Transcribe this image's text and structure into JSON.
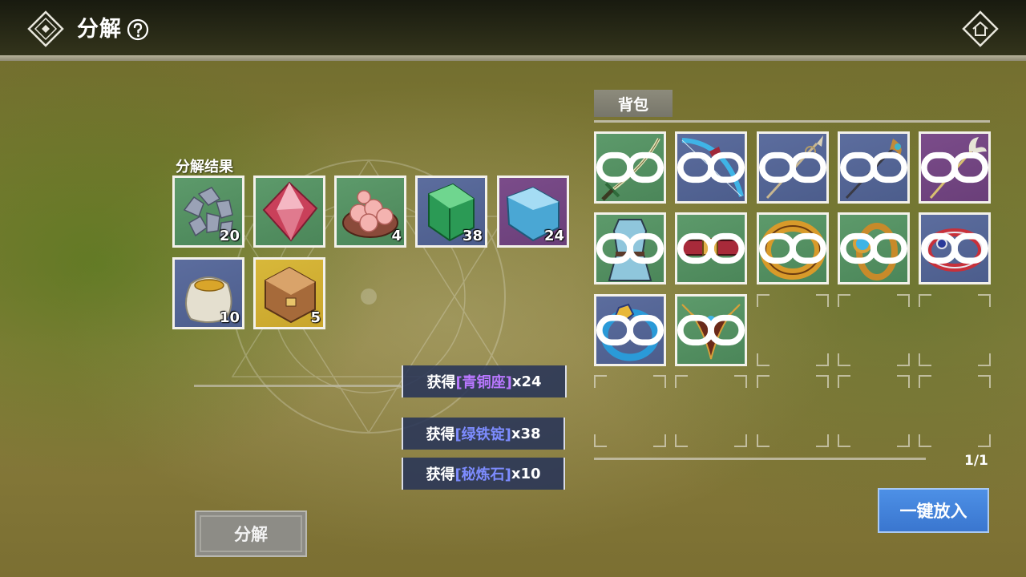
{
  "header": {
    "title": "分解"
  },
  "result": {
    "label": "分解结果",
    "items": [
      {
        "name": "ore",
        "count": "20",
        "bg": "green"
      },
      {
        "name": "red-gem",
        "count": "",
        "bg": "green"
      },
      {
        "name": "pink-eggs",
        "count": "4",
        "bg": "green"
      },
      {
        "name": "green-ingot",
        "count": "38",
        "bg": "blue"
      },
      {
        "name": "blue-bronze",
        "count": "24",
        "bg": "purple"
      },
      {
        "name": "gold-bag",
        "count": "10",
        "bg": "blue"
      },
      {
        "name": "chest",
        "count": "5",
        "bg": "gold"
      }
    ]
  },
  "gains": [
    {
      "prefix": "获得",
      "item": "[青铜座]",
      "suffix": "x24"
    },
    {
      "prefix": "获得",
      "item": "[绿铁锭]",
      "suffix": "x38"
    },
    {
      "prefix": "获得",
      "item": "[秘炼石]",
      "suffix": "x10"
    }
  ],
  "bag": {
    "title": "背包",
    "page": "1/1",
    "items": [
      {
        "name": "sword",
        "bg": "green"
      },
      {
        "name": "bow",
        "bg": "blue"
      },
      {
        "name": "spear",
        "bg": "blue"
      },
      {
        "name": "halberd",
        "bg": "blue"
      },
      {
        "name": "staff",
        "bg": "purple"
      },
      {
        "name": "armor",
        "bg": "green"
      },
      {
        "name": "belt",
        "bg": "green"
      },
      {
        "name": "gold-ring",
        "bg": "green"
      },
      {
        "name": "gem-ring",
        "bg": "green"
      },
      {
        "name": "red-bracelet",
        "bg": "blue"
      },
      {
        "name": "blue-bracelet",
        "bg": "blue"
      },
      {
        "name": "horned-amulet",
        "bg": "green"
      }
    ]
  },
  "buttons": {
    "decompose": "分解",
    "one_key": "一键放入"
  }
}
